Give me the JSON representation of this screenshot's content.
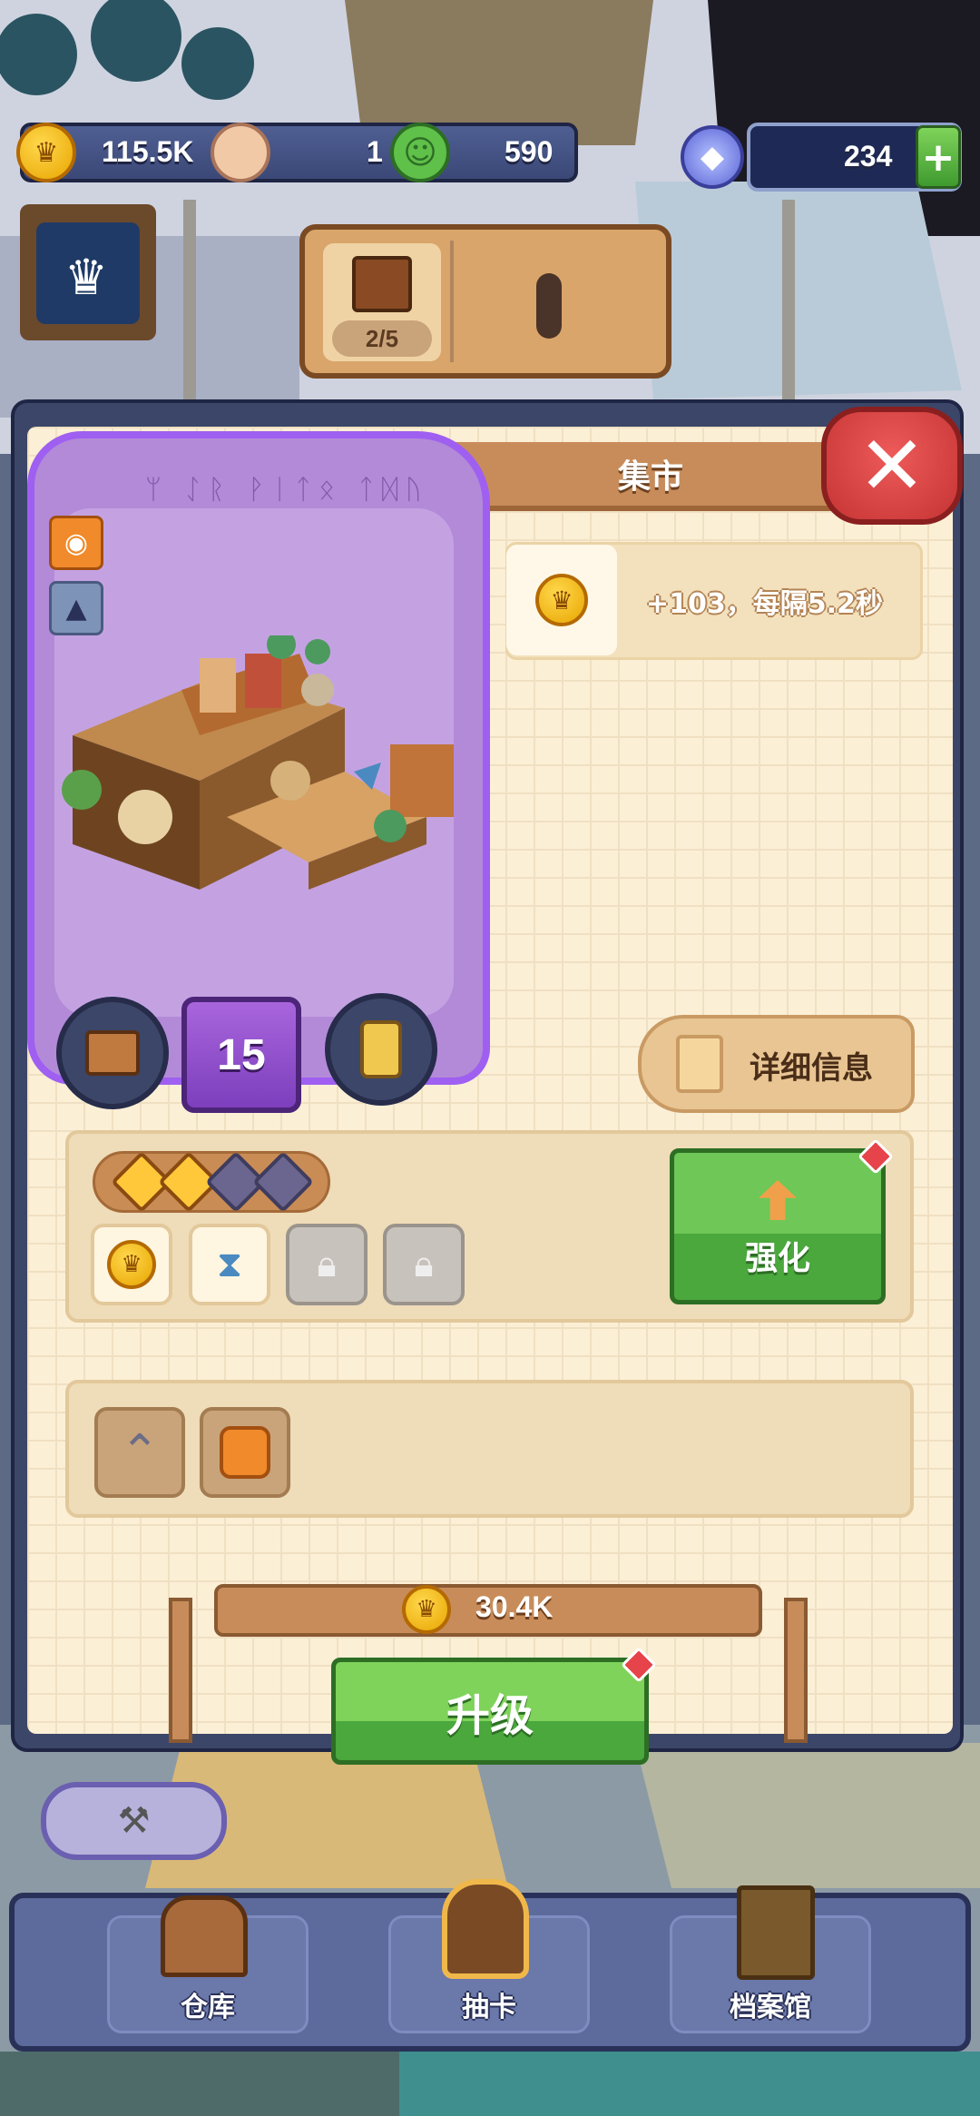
{
  "resources": {
    "gold_value": "115.5K",
    "gold_icon": "crown-coin-icon",
    "population_value": "1",
    "population_icon": "villager-icon",
    "happiness_value": "590",
    "happiness_icon": "smiley-icon",
    "gems_value": "234",
    "gems_icon": "gem-icon",
    "add_symbol": "+"
  },
  "chest_sign": {
    "count": "2/5",
    "icon": "treasure-chest-icon"
  },
  "panel": {
    "title": "集市",
    "close_symbol": "✕",
    "building": {
      "runes": "ᛘ ᛇᚱ ᚹᛁᛏᛟ ᛏᛞᚢ",
      "level": "15",
      "tag_icons": [
        "coin-bag-icon",
        "wolf-icon"
      ],
      "left_button_icon": "collect-box-icon",
      "right_button_icon": "lantern-icon"
    },
    "production": {
      "text": "+103，每隔5.2秒",
      "icon": "crown-coin-icon"
    },
    "details_label": "详细信息",
    "enhance": {
      "stars_filled": 2,
      "stars_total": 4,
      "skills": [
        {
          "icon": "coin-boost-icon",
          "locked": false
        },
        {
          "icon": "hourglass-icon",
          "locked": false
        },
        {
          "icon": "lock-icon",
          "locked": true
        },
        {
          "icon": "lock-icon",
          "locked": true
        }
      ],
      "button_label": "强化",
      "button_icon": "enhance-arrow-icon"
    },
    "bonuses": [
      {
        "icon": "rank-chevron-icon"
      },
      {
        "icon": "coin-bag-upgrade-icon"
      }
    ],
    "upgrade": {
      "cost": "30.4K",
      "button_label": "升级"
    }
  },
  "bottom_nav": {
    "hammer_icon": "hammer-icon",
    "items": [
      {
        "label": "仓库",
        "icon": "warehouse-icon"
      },
      {
        "label": "抽卡",
        "icon": "card-draw-icon"
      },
      {
        "label": "档案馆",
        "icon": "archive-icon"
      }
    ]
  },
  "colors": {
    "panel_bg": "#fbefd6",
    "accent_green": "#4aa83d",
    "close_red": "#c53434",
    "level_purple": "#7d3fbd",
    "frame_navy": "#3c4668"
  }
}
